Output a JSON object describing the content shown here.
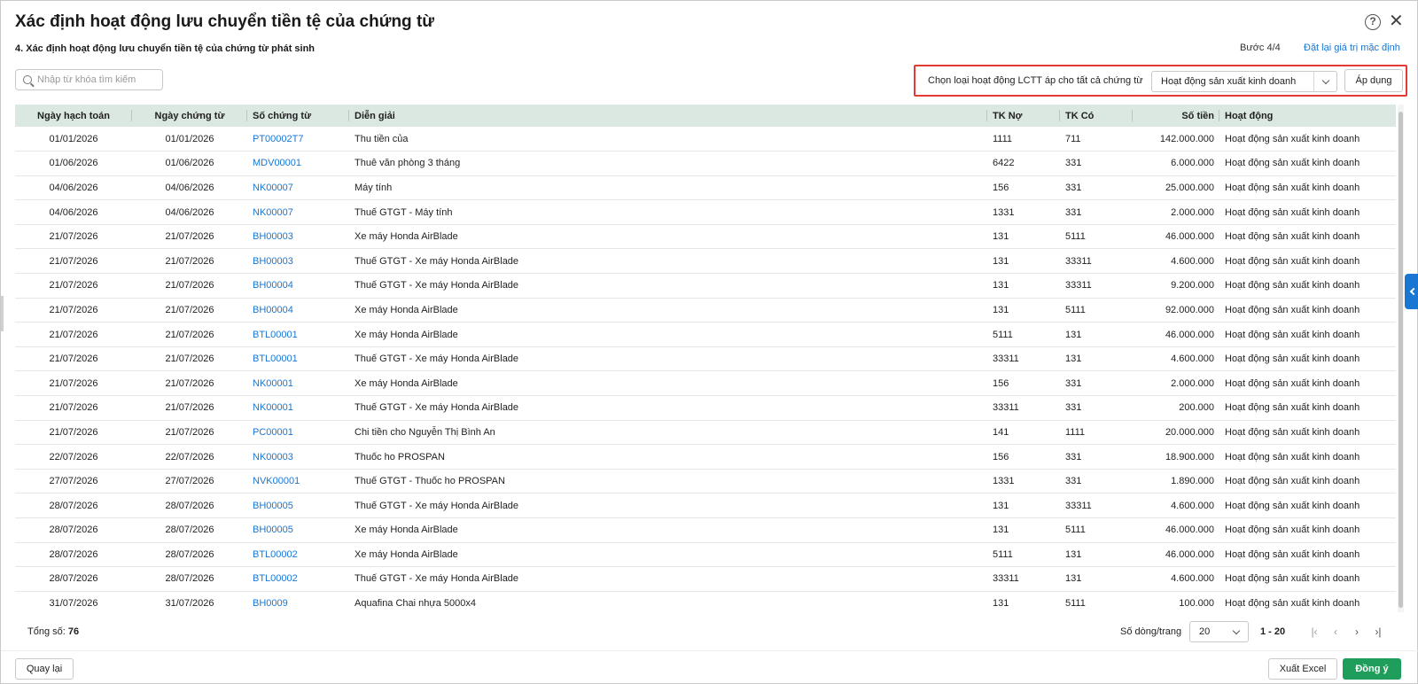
{
  "dialog": {
    "title": "Xác định hoạt động lưu chuyển tiền tệ của chứng từ",
    "help_icon": "?",
    "close_icon": "✕",
    "subtitle": "4. Xác định hoạt động lưu chuyển tiền tệ của chứng từ phát sinh",
    "step": "Bước 4/4",
    "reset_link": "Đặt lại giá trị mặc định"
  },
  "search": {
    "placeholder": "Nhập từ khóa tìm kiếm",
    "value": ""
  },
  "bulk_apply": {
    "label": "Chọn loại hoạt động LCTT áp cho tất cả chứng từ",
    "selected": "Hoạt động sản xuất kinh doanh",
    "button": "Áp dụng"
  },
  "table": {
    "columns": [
      "Ngày hạch toán",
      "Ngày chứng từ",
      "Số chứng từ",
      "Diễn giải",
      "TK Nợ",
      "TK Có",
      "Số tiền",
      "Hoạt động"
    ],
    "rows": [
      [
        "01/01/2026",
        "01/01/2026",
        "PT00002T7",
        "Thu tiền của",
        "1111",
        "711",
        "142.000.000",
        "Hoạt động sản xuất kinh doanh"
      ],
      [
        "01/06/2026",
        "01/06/2026",
        "MDV00001",
        "Thuê văn phòng 3 tháng",
        "6422",
        "331",
        "6.000.000",
        "Hoạt động sản xuất kinh doanh"
      ],
      [
        "04/06/2026",
        "04/06/2026",
        "NK00007",
        "Máy tính",
        "156",
        "331",
        "25.000.000",
        "Hoạt động sản xuất kinh doanh"
      ],
      [
        "04/06/2026",
        "04/06/2026",
        "NK00007",
        "Thuế GTGT - Máy tính",
        "1331",
        "331",
        "2.000.000",
        "Hoạt động sản xuất kinh doanh"
      ],
      [
        "21/07/2026",
        "21/07/2026",
        "BH00003",
        "Xe máy Honda AirBlade",
        "131",
        "5111",
        "46.000.000",
        "Hoạt động sản xuất kinh doanh"
      ],
      [
        "21/07/2026",
        "21/07/2026",
        "BH00003",
        "Thuế GTGT - Xe máy Honda AirBlade",
        "131",
        "33311",
        "4.600.000",
        "Hoạt động sản xuất kinh doanh"
      ],
      [
        "21/07/2026",
        "21/07/2026",
        "BH00004",
        "Thuế GTGT - Xe máy Honda AirBlade",
        "131",
        "33311",
        "9.200.000",
        "Hoạt động sản xuất kinh doanh"
      ],
      [
        "21/07/2026",
        "21/07/2026",
        "BH00004",
        "Xe máy Honda AirBlade",
        "131",
        "5111",
        "92.000.000",
        "Hoạt động sản xuất kinh doanh"
      ],
      [
        "21/07/2026",
        "21/07/2026",
        "BTL00001",
        "Xe máy Honda AirBlade",
        "5111",
        "131",
        "46.000.000",
        "Hoạt động sản xuất kinh doanh"
      ],
      [
        "21/07/2026",
        "21/07/2026",
        "BTL00001",
        "Thuế GTGT - Xe máy Honda AirBlade",
        "33311",
        "131",
        "4.600.000",
        "Hoạt động sản xuất kinh doanh"
      ],
      [
        "21/07/2026",
        "21/07/2026",
        "NK00001",
        "Xe máy Honda AirBlade",
        "156",
        "331",
        "2.000.000",
        "Hoạt động sản xuất kinh doanh"
      ],
      [
        "21/07/2026",
        "21/07/2026",
        "NK00001",
        "Thuế GTGT - Xe máy Honda AirBlade",
        "33311",
        "331",
        "200.000",
        "Hoạt động sản xuất kinh doanh"
      ],
      [
        "21/07/2026",
        "21/07/2026",
        "PC00001",
        "Chi tiền cho Nguyễn Thị Bình An",
        "141",
        "1111",
        "20.000.000",
        "Hoạt động sản xuất kinh doanh"
      ],
      [
        "22/07/2026",
        "22/07/2026",
        "NK00003",
        "Thuốc ho PROSPAN",
        "156",
        "331",
        "18.900.000",
        "Hoạt động sản xuất kinh doanh"
      ],
      [
        "27/07/2026",
        "27/07/2026",
        "NVK00001",
        "Thuế GTGT - Thuốc ho PROSPAN",
        "1331",
        "331",
        "1.890.000",
        "Hoạt động sản xuất kinh doanh"
      ],
      [
        "28/07/2026",
        "28/07/2026",
        "BH00005",
        "Thuế GTGT - Xe máy Honda AirBlade",
        "131",
        "33311",
        "4.600.000",
        "Hoạt động sản xuất kinh doanh"
      ],
      [
        "28/07/2026",
        "28/07/2026",
        "BH00005",
        "Xe máy Honda AirBlade",
        "131",
        "5111",
        "46.000.000",
        "Hoạt động sản xuất kinh doanh"
      ],
      [
        "28/07/2026",
        "28/07/2026",
        "BTL00002",
        "Xe máy Honda AirBlade",
        "5111",
        "131",
        "46.000.000",
        "Hoạt động sản xuất kinh doanh"
      ],
      [
        "28/07/2026",
        "28/07/2026",
        "BTL00002",
        "Thuế GTGT - Xe máy Honda AirBlade",
        "33311",
        "131",
        "4.600.000",
        "Hoạt động sản xuất kinh doanh"
      ],
      [
        "31/07/2026",
        "31/07/2026",
        "BH0009",
        "Aquafina Chai nhựa 5000x4",
        "131",
        "5111",
        "100.000",
        "Hoạt động sản xuất kinh doanh"
      ]
    ]
  },
  "pagination": {
    "total_label": "Tổng số:",
    "total_value": "76",
    "rows_per_page_label": "Số dòng/trang",
    "rows_per_page": "20",
    "range": "1 - 20",
    "first_icon": "|‹",
    "prev_icon": "‹",
    "next_icon": "›",
    "last_icon": "›|"
  },
  "footer": {
    "back": "Quay lại",
    "export": "Xuất Excel",
    "ok": "Đồng ý"
  },
  "colors": {
    "header_bg": "#dbe8e1",
    "link": "#1976d2",
    "primary": "#1e9e5a",
    "highlight_border": "#e53935"
  }
}
